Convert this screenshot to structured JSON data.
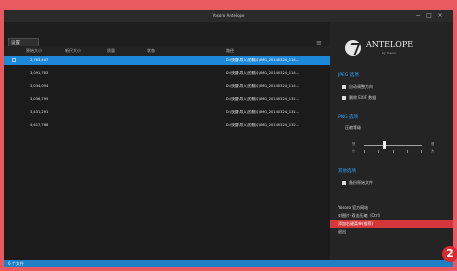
{
  "window": {
    "title": "Yosoro Antelope",
    "minimize": "−",
    "maximize": "□",
    "close": "×"
  },
  "toolbar": {
    "search_value": "设置",
    "search_icon": "≡"
  },
  "table": {
    "headers": [
      "原始大小",
      "新尺大小",
      "质量",
      "状态",
      "路径"
    ],
    "rows": [
      {
        "size": "2,763,447",
        "path": "D:\\快捷\\导入\\的照片\\IMG_20140324_114...",
        "selected": true
      },
      {
        "size": "3,091,783",
        "path": "D:\\快捷\\导入\\的照片\\IMG_20140324_114...",
        "selected": false
      },
      {
        "size": "3,034,094",
        "path": "D:\\快捷\\导入\\的照片\\IMG_20140324_114...",
        "selected": false
      },
      {
        "size": "3,036,795",
        "path": "D:\\快捷\\导入\\的照片\\IMG_20140324_131...",
        "selected": false
      },
      {
        "size": "3,431,291",
        "path": "D:\\快捷\\导入\\的照片\\IMG_20140324_131...",
        "selected": false
      },
      {
        "size": "4,617,768",
        "path": "D:\\快捷\\导入\\的照片\\IMG_20140324_132...",
        "selected": false
      }
    ]
  },
  "sidebar": {
    "brand": "ANTELOPE",
    "brand_sub": "by Yosoro",
    "jpeg_title": "JPEG 选项",
    "jpeg_options": [
      "自动调整方向",
      "删除 EXIF 数据"
    ],
    "png_title": "PNG 选项",
    "png_level_label": "压缩等级",
    "png_level_left_1": "快",
    "png_level_left_2": "小",
    "png_level_right_1": "慢",
    "png_level_right_2": "大",
    "png_level_value": 0.35,
    "file_title": "其他选项",
    "file_option": "备份原始文件",
    "menu": [
      "Yosoro 官方网站",
      "对图片-双击压缩（Ctrl）",
      "添加右键菜单(推荐)",
      "退出"
    ]
  },
  "status": {
    "text": "6 个文件"
  },
  "annotation": {
    "badge": "2"
  },
  "colors": {
    "accent": "#1e88d8",
    "menu_highlight": "#d4373b",
    "badge": "#d82a2f"
  }
}
